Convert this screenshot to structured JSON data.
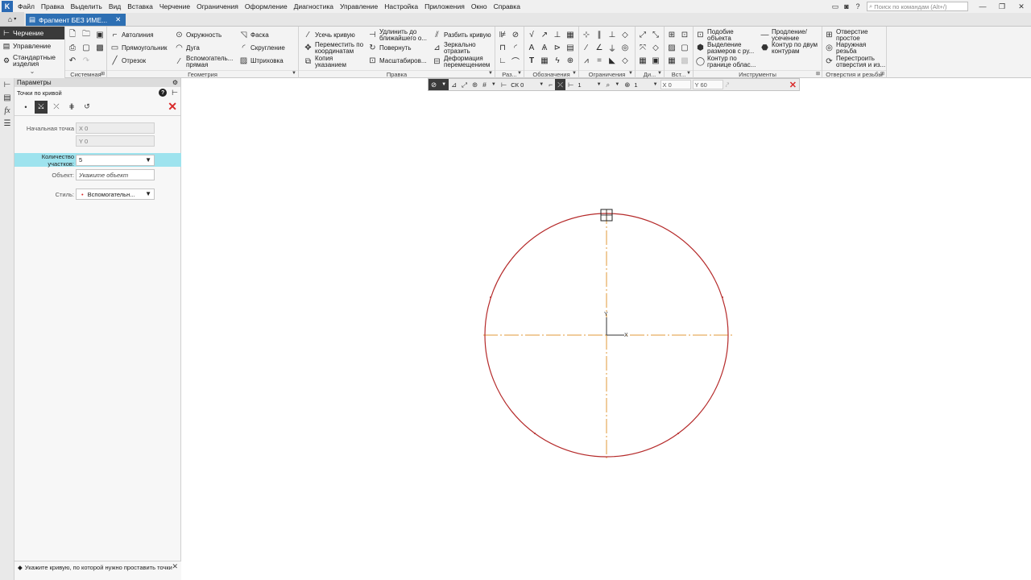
{
  "menu": {
    "items": [
      "Файл",
      "Правка",
      "Выделить",
      "Вид",
      "Вставка",
      "Черчение",
      "Ограничения",
      "Оформление",
      "Диагностика",
      "Управление",
      "Настройка",
      "Приложения",
      "Окно",
      "Справка"
    ],
    "search_placeholder": "Поиск по командам (Alt+/)"
  },
  "tab": {
    "title": "Фрагмент БЕЗ ИМЕ..."
  },
  "ribbon": {
    "modes": [
      "Черчение",
      "Управление",
      "Стандартные изделия"
    ],
    "groups": {
      "system": "Системная",
      "geometry": "Геометрия",
      "edit": "Правка",
      "sizes": "Раз...",
      "marks": "Обозначения",
      "constraints": "Ограничения",
      "diag": "Ди...",
      "insert": "Вст...",
      "tools": "Инструменты",
      "holes": "Отверстия и резьбы"
    },
    "geometry_cmds": [
      "Автолиния",
      "Прямоугольник",
      "Отрезок",
      "Окружность",
      "Дуга",
      "Вспомогатель... прямая",
      "Фаска",
      "Скругление",
      "Штриховка"
    ],
    "edit_cmds": [
      "Усечь кривую",
      "Переместить по координатам",
      "Копия указанием",
      "Удлинить до ближайшего о...",
      "Повернуть",
      "Масштабиров...",
      "Разбить кривую",
      "Зеркально отразить",
      "Деформация перемещением"
    ],
    "tools_cmds": [
      "Подобие объекта",
      "Выделение размеров с ру...",
      "Контур по границе облас...",
      "Продление/ усечение",
      "Контур по двум контурам"
    ],
    "holes_cmds": [
      "Отверстие простое",
      "Наружная резьба",
      "Перестроить отверстия и из..."
    ]
  },
  "params": {
    "header": "Параметры",
    "title": "Точки по кривой",
    "start_point_label": "Начальная точка",
    "x_value": "X  0",
    "y_value": "Y  0",
    "count_label": "Количество участков:",
    "count_value": "5",
    "object_label": "Объект:",
    "object_placeholder": "Укажите объект",
    "style_label": "Стиль:",
    "style_value": "Вспомогательн...",
    "hint": "Укажите кривую, по которой нужно проставить точки"
  },
  "float_toolbar": {
    "cs": "СК 0",
    "step": "1",
    "zoom": "1",
    "x": "X 0",
    "y": "Y 60"
  },
  "colors": {
    "accent": "#2d6fb3",
    "circle": "#b52a2a",
    "axis": "#e09a3a",
    "highlight_row": "#9ee3ee",
    "cancel": "#d92a2a"
  }
}
